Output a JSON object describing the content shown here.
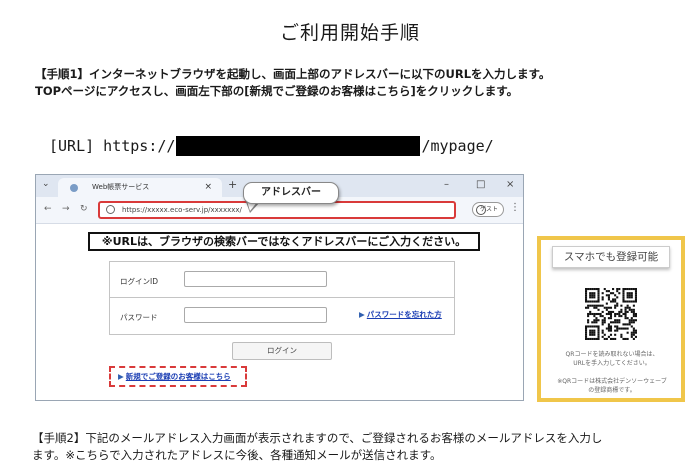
{
  "title": "ご利用開始手順",
  "step1": {
    "line1": "【手順1】インターネットブラウザを起動し、画面上部のアドレスバーに以下のURLを入力します。",
    "line2": "TOPページにアクセスし、画面左下部の[新規でご登録のお客様はこちら]をクリックします。"
  },
  "url": {
    "prefix": "[URL] https://",
    "suffix": "/mypage/"
  },
  "browser": {
    "tab_title": "Web帳票サービス",
    "tab_close": "×",
    "new_tab": "+",
    "window_controls": [
      "⌄",
      "–",
      "□",
      "×"
    ],
    "address": "https://xxxxx.eco-serv.jp/xxxxxxx/",
    "guest_label": "ゲスト",
    "callout": "アドレスバー",
    "notice": "※URLは、ブラウザの検索バーではなくアドレスバーにご入力ください。",
    "login_id_label": "ログインID",
    "password_label": "パスワード",
    "forgot_password": "パスワードを忘れた方",
    "login_button": "ログイン",
    "register_link": "新規でご登録のお客様はこちら",
    "icons": {
      "back": "back-arrow-icon",
      "forward": "forward-arrow-icon",
      "reload": "reload-icon",
      "menu": "kebab-menu-icon"
    }
  },
  "phone": {
    "label": "スマホでも登録可能",
    "note1_line1": "QRコードを読み取れない場合は、",
    "note1_line2": "URLを手入力してください。",
    "note2_line1": "※QRコードは株式会社デンソーウェーブ",
    "note2_line2": "の登録商標です。"
  },
  "step2": {
    "line1": "【手順2】下記のメールアドレス入力画面が表示されますので、ご登録されるお客様のメールアドレスを入力し",
    "line2": "ます。※こちらで入力されたアドレスに今後、各種通知メールが送信されます。"
  },
  "colors": {
    "highlight_red": "#d93a3a",
    "link_blue": "#1a3db3",
    "qr_frame_yellow": "#f0c64a"
  }
}
